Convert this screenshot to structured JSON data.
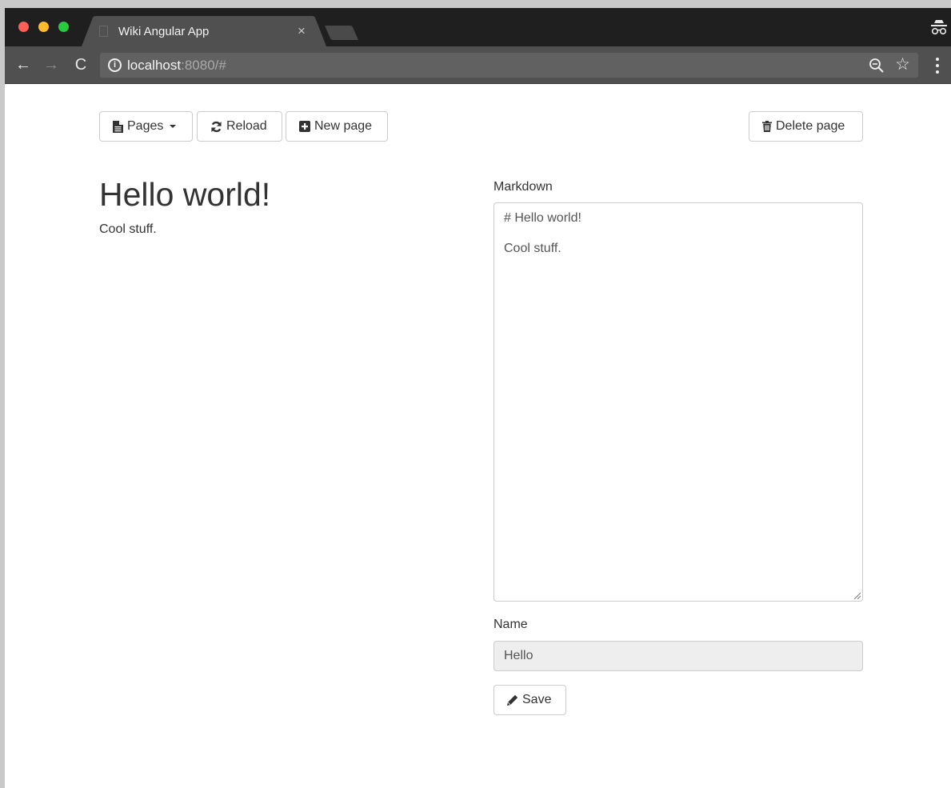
{
  "browser": {
    "tab_title": "Wiki Angular App",
    "tab_close": "×",
    "url_host": "localhost",
    "url_rest": ":8080/#",
    "nav_back": "←",
    "nav_forward": "→",
    "nav_reload": "C",
    "star": "☆"
  },
  "toolbar": {
    "pages_label": "Pages",
    "reload_label": "Reload",
    "new_page_label": "New page",
    "delete_page_label": "Delete page"
  },
  "preview": {
    "heading": "Hello world!",
    "paragraph": "Cool stuff."
  },
  "editor": {
    "markdown_label": "Markdown",
    "markdown_value": "# Hello world!\n\nCool stuff.",
    "name_label": "Name",
    "name_value": "Hello",
    "save_label": "Save"
  },
  "icons": {
    "pages": "file-icon",
    "reload": "refresh-icon",
    "new_page": "plus-square-icon",
    "delete_page": "trash-icon",
    "save": "pencil-icon"
  }
}
